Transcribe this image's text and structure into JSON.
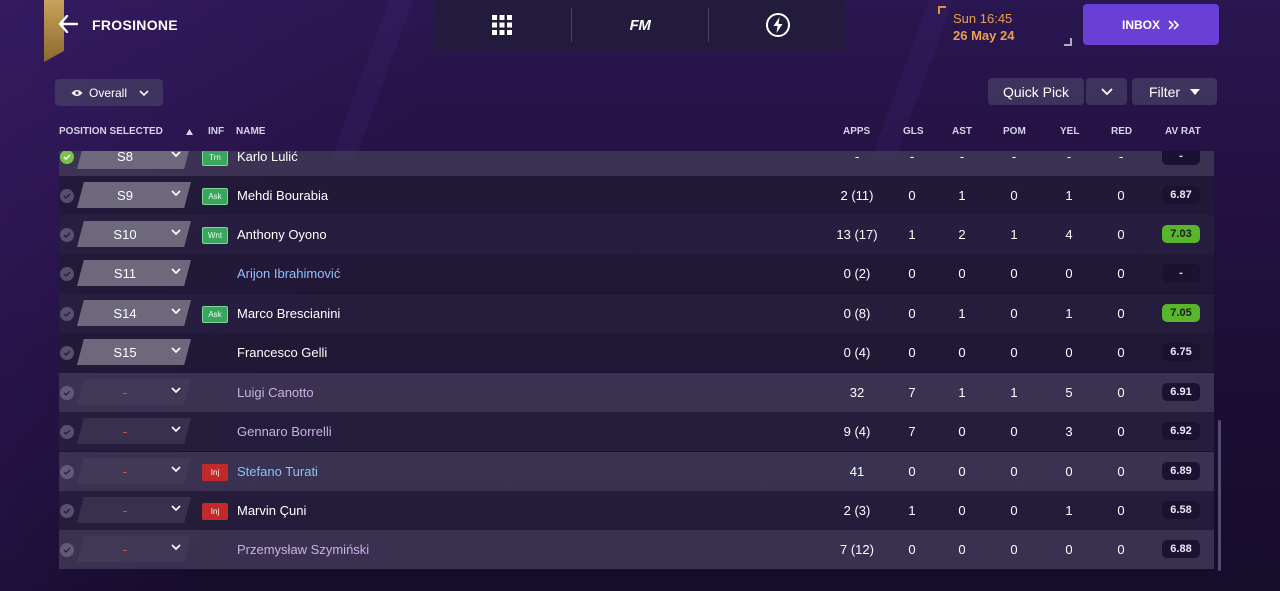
{
  "header": {
    "club_name": "FROSINONE",
    "fm_logo": "FM",
    "date_day": "Sun 16:45",
    "date_date": "26 May 24",
    "inbox_label": "INBOX"
  },
  "controls": {
    "view_label": "Overall",
    "quick_pick_label": "Quick Pick",
    "filter_label": "Filter"
  },
  "columns": {
    "position": "POSITION SELECTED",
    "inf": "INF",
    "name": "NAME",
    "apps": "APPS",
    "gls": "GLS",
    "ast": "AST",
    "pom": "POM",
    "yel": "YEL",
    "red": "RED",
    "avrat": "AV RAT"
  },
  "rows": [
    {
      "pos": "S8",
      "inf": "Trn",
      "inf_color": "green",
      "name": "Karlo Lulić",
      "name_color": "white",
      "apps": "-",
      "gls": "-",
      "ast": "-",
      "pom": "-",
      "yel": "-",
      "red": "-",
      "avrat": "-",
      "avrat_good": false,
      "checked": true
    },
    {
      "pos": "S9",
      "inf": "Ask",
      "inf_color": "green",
      "name": "Mehdi Bourabia",
      "name_color": "white",
      "apps": "2 (11)",
      "gls": "0",
      "ast": "1",
      "pom": "0",
      "yel": "1",
      "red": "0",
      "avrat": "6.87",
      "avrat_good": false,
      "checked": false
    },
    {
      "pos": "S10",
      "inf": "Wnt",
      "inf_color": "green",
      "name": "Anthony Oyono",
      "name_color": "white",
      "apps": "13 (17)",
      "gls": "1",
      "ast": "2",
      "pom": "1",
      "yel": "4",
      "red": "0",
      "avrat": "7.03",
      "avrat_good": true,
      "checked": false
    },
    {
      "pos": "S11",
      "inf": "",
      "inf_color": "",
      "name": "Arijon Ibrahimović",
      "name_color": "blue",
      "apps": "0 (2)",
      "gls": "0",
      "ast": "0",
      "pom": "0",
      "yel": "0",
      "red": "0",
      "avrat": "-",
      "avrat_good": false,
      "checked": false
    },
    {
      "pos": "S14",
      "inf": "Ask",
      "inf_color": "green",
      "name": "Marco Brescianini",
      "name_color": "white",
      "apps": "0 (8)",
      "gls": "0",
      "ast": "1",
      "pom": "0",
      "yel": "1",
      "red": "0",
      "avrat": "7.05",
      "avrat_good": true,
      "checked": false
    },
    {
      "pos": "S15",
      "inf": "",
      "inf_color": "",
      "name": "Francesco Gelli",
      "name_color": "white",
      "apps": "0 (4)",
      "gls": "0",
      "ast": "0",
      "pom": "0",
      "yel": "0",
      "red": "0",
      "avrat": "6.75",
      "avrat_good": false,
      "checked": false
    },
    {
      "pos": "-",
      "inf": "",
      "inf_color": "",
      "name": "Luigi Canotto",
      "name_color": "lilac",
      "apps": "32",
      "gls": "7",
      "ast": "1",
      "pom": "1",
      "yel": "5",
      "red": "0",
      "avrat": "6.91",
      "avrat_good": false,
      "checked": false
    },
    {
      "pos": "-",
      "inf": "",
      "inf_color": "",
      "name": "Gennaro Borrelli",
      "name_color": "lilac",
      "apps": "9 (4)",
      "gls": "7",
      "ast": "0",
      "pom": "0",
      "yel": "3",
      "red": "0",
      "avrat": "6.92",
      "avrat_good": false,
      "checked": false
    },
    {
      "pos": "-",
      "inf": "Inj",
      "inf_color": "red",
      "name": "Stefano Turati",
      "name_color": "blue",
      "apps": "41",
      "gls": "0",
      "ast": "0",
      "pom": "0",
      "yel": "0",
      "red": "0",
      "avrat": "6.89",
      "avrat_good": false,
      "checked": false
    },
    {
      "pos": "-",
      "inf": "Inj",
      "inf_color": "red",
      "name": "Marvin Çuni",
      "name_color": "white",
      "apps": "2 (3)",
      "gls": "1",
      "ast": "0",
      "pom": "0",
      "yel": "1",
      "red": "0",
      "avrat": "6.58",
      "avrat_good": false,
      "checked": false
    },
    {
      "pos": "-",
      "inf": "",
      "inf_color": "",
      "name": "Przemysław Szymiński",
      "name_color": "lilac",
      "apps": "7 (12)",
      "gls": "0",
      "ast": "0",
      "pom": "0",
      "yel": "0",
      "red": "0",
      "avrat": "6.88",
      "avrat_good": false,
      "checked": false
    }
  ]
}
